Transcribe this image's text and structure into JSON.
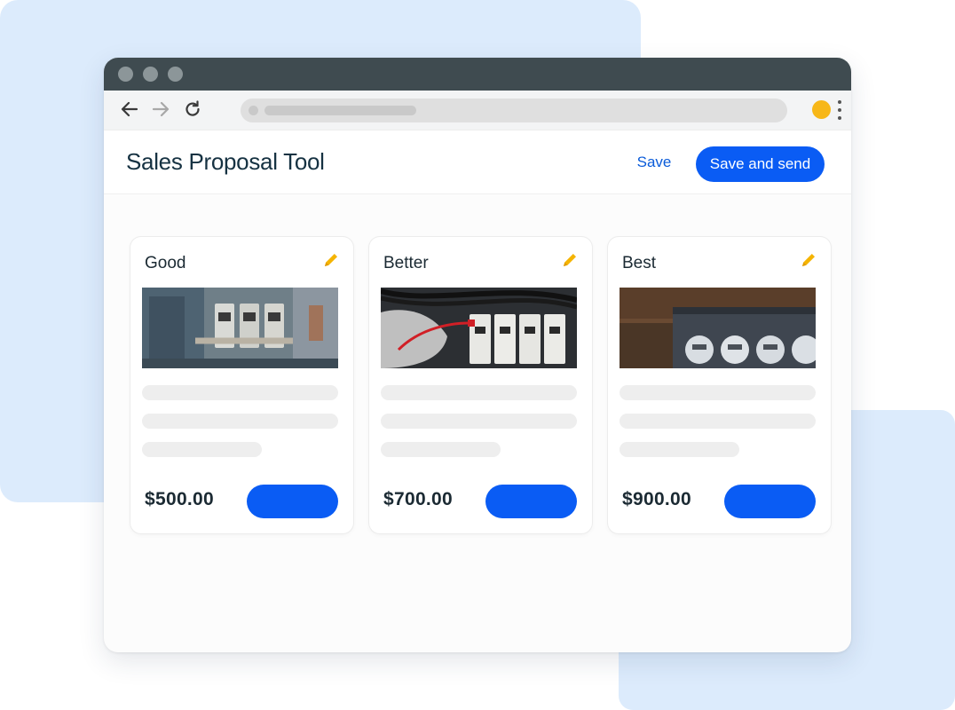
{
  "app": {
    "title": "Sales Proposal Tool",
    "save_label": "Save",
    "save_send_label": "Save and send"
  },
  "browser": {
    "icons": [
      "back-arrow-icon",
      "forward-arrow-icon",
      "reload-icon",
      "profile-icon",
      "kebab-menu-icon"
    ]
  },
  "cards": [
    {
      "title": "Good",
      "price": "$500.00",
      "image": "electrical-panel-open-photo",
      "edit_icon": "pencil-icon"
    },
    {
      "title": "Better",
      "price": "$700.00",
      "image": "circuit-breaker-testing-photo",
      "edit_icon": "pencil-icon"
    },
    {
      "title": "Best",
      "price": "$900.00",
      "image": "electric-meters-photo",
      "edit_icon": "pencil-icon"
    }
  ],
  "colors": {
    "primary": "#0a5cf4",
    "link": "#0a5bd9",
    "edit_icon": "#f5b400",
    "profile": "#f7b718",
    "title_text": "#163242",
    "background_shape": "#dcebfc",
    "titlebar": "#3f4b50"
  }
}
